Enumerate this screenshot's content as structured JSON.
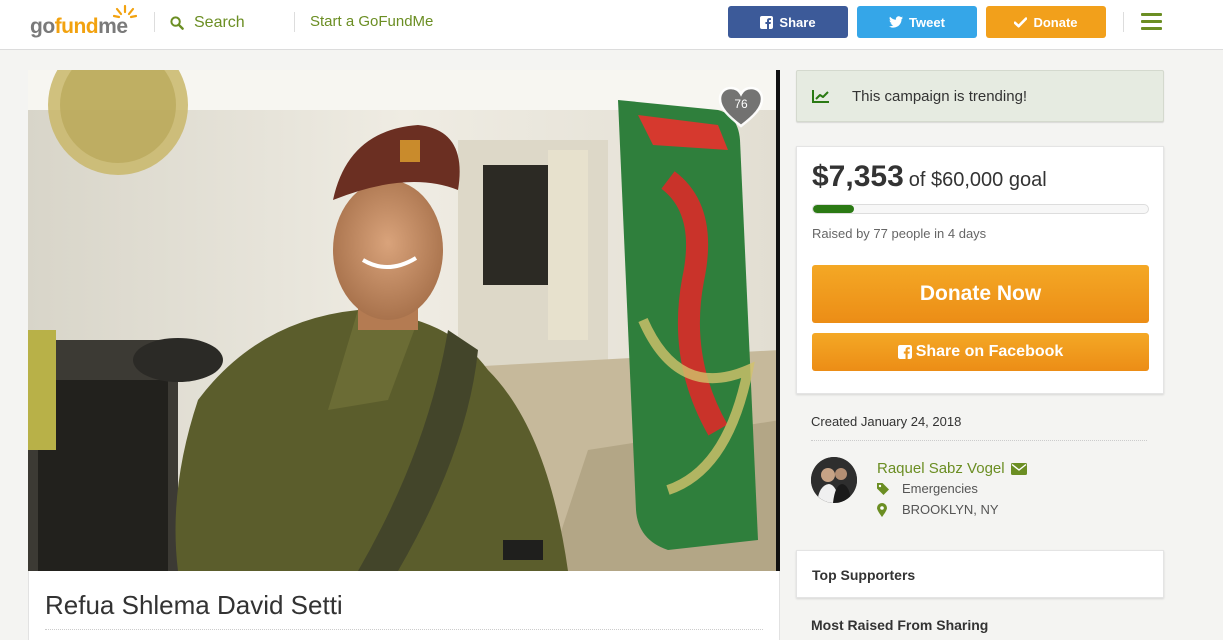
{
  "header": {
    "logo": "gofundme",
    "search_label": "Search",
    "start_link": "Start a GoFundMe",
    "share_label": "Share",
    "tweet_label": "Tweet",
    "donate_label": "Donate"
  },
  "campaign": {
    "title": "Refua Shlema David Setti",
    "photo_alt": "Campaign photo: young man in olive military uniform and beret smiling, standing next to a painted green sign outside a building",
    "heart_count": "76"
  },
  "sidebar": {
    "trending_text": "This campaign is trending!",
    "raised_amount": "$7,353",
    "goal_text": "of $60,000 goal",
    "progress_fraction": 0.1226,
    "raised_by": "Raised by 77 people in 4 days",
    "donate_now": "Donate Now",
    "share_facebook": "Share on Facebook",
    "created": "Created January 24, 2018",
    "organizer_name": "Raquel Sabz Vogel",
    "category": "Emergencies",
    "location": "BROOKLYN, NY",
    "top_supporters": "Top Supporters",
    "most_raised": "Most Raised From Sharing"
  },
  "colors": {
    "brand_green": "#6b8e23",
    "facebook_blue": "#3c5a99",
    "twitter_blue": "#35a6e8",
    "donate_orange": "#f2a01b",
    "progress_green": "#2b7a14"
  },
  "icons": [
    "search-icon",
    "facebook-icon",
    "twitter-icon",
    "check-icon",
    "menu-icon",
    "heart-icon",
    "trending-icon",
    "envelope-icon",
    "tag-icon",
    "map-marker-icon"
  ]
}
